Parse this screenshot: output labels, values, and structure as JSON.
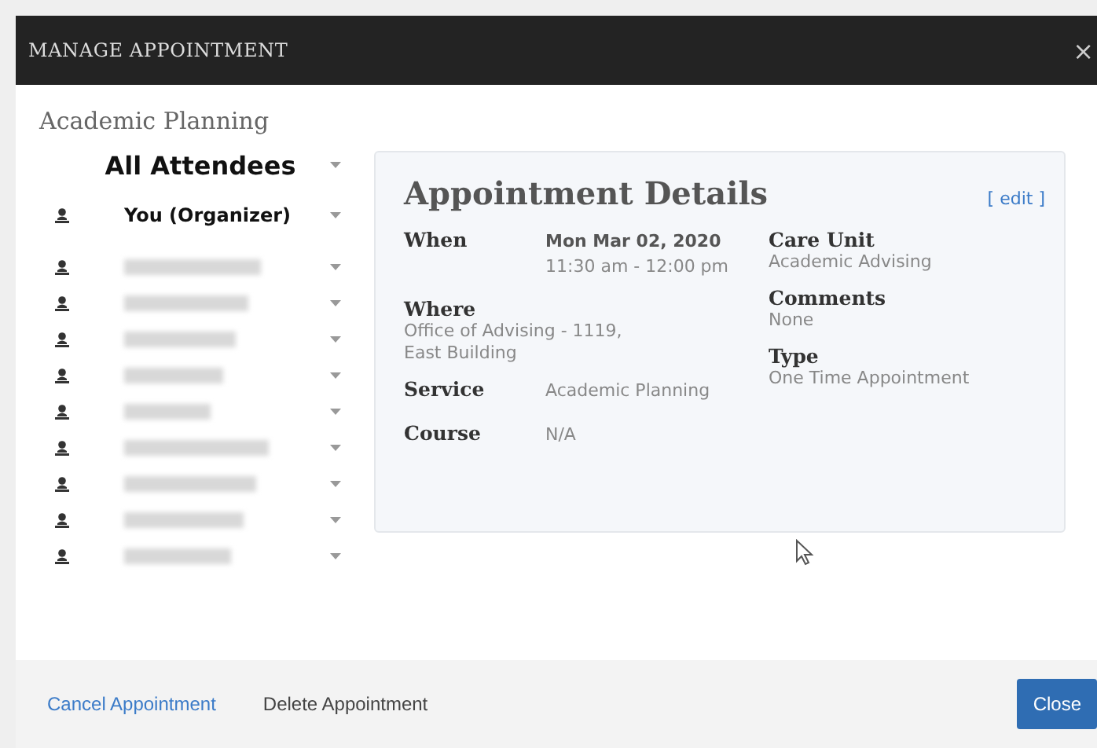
{
  "window": {
    "title": "MANAGE APPOINTMENT",
    "close": "×"
  },
  "subtitle": "Academic Planning",
  "attendees": {
    "heading": "All Attendees",
    "items": [
      {
        "kind": "named",
        "name": "You (Organizer)"
      },
      {
        "kind": "blurred"
      },
      {
        "kind": "blurred"
      },
      {
        "kind": "blurred"
      },
      {
        "kind": "blurred"
      },
      {
        "kind": "blurred"
      },
      {
        "kind": "blurred"
      },
      {
        "kind": "blurred"
      },
      {
        "kind": "blurred"
      },
      {
        "kind": "blurred"
      }
    ]
  },
  "details": {
    "title": "Appointment Details",
    "edit": "[ edit ]",
    "left": [
      {
        "kind": "inline",
        "label": "When",
        "value": "Mon Mar 02, 2020",
        "value2": "11:30 am - 12:00 pm"
      },
      {
        "kind": "stacked",
        "label": "Where",
        "value": "Office of Advising - 1119,",
        "value2": "East Building"
      },
      {
        "kind": "inline",
        "label": "Service",
        "value": "Academic Planning"
      },
      {
        "kind": "inline",
        "label": "Course",
        "value": "N/A"
      }
    ],
    "right": [
      {
        "kind": "stacked",
        "label": "Care Unit",
        "value": "Academic Advising"
      },
      {
        "kind": "stacked",
        "label": "Comments",
        "value": "None"
      },
      {
        "kind": "stacked",
        "label": "Type",
        "value": "One Time Appointment"
      }
    ]
  },
  "footer": {
    "cancel": "Cancel Appointment",
    "delete": "Delete Appointment",
    "close": "Close"
  }
}
